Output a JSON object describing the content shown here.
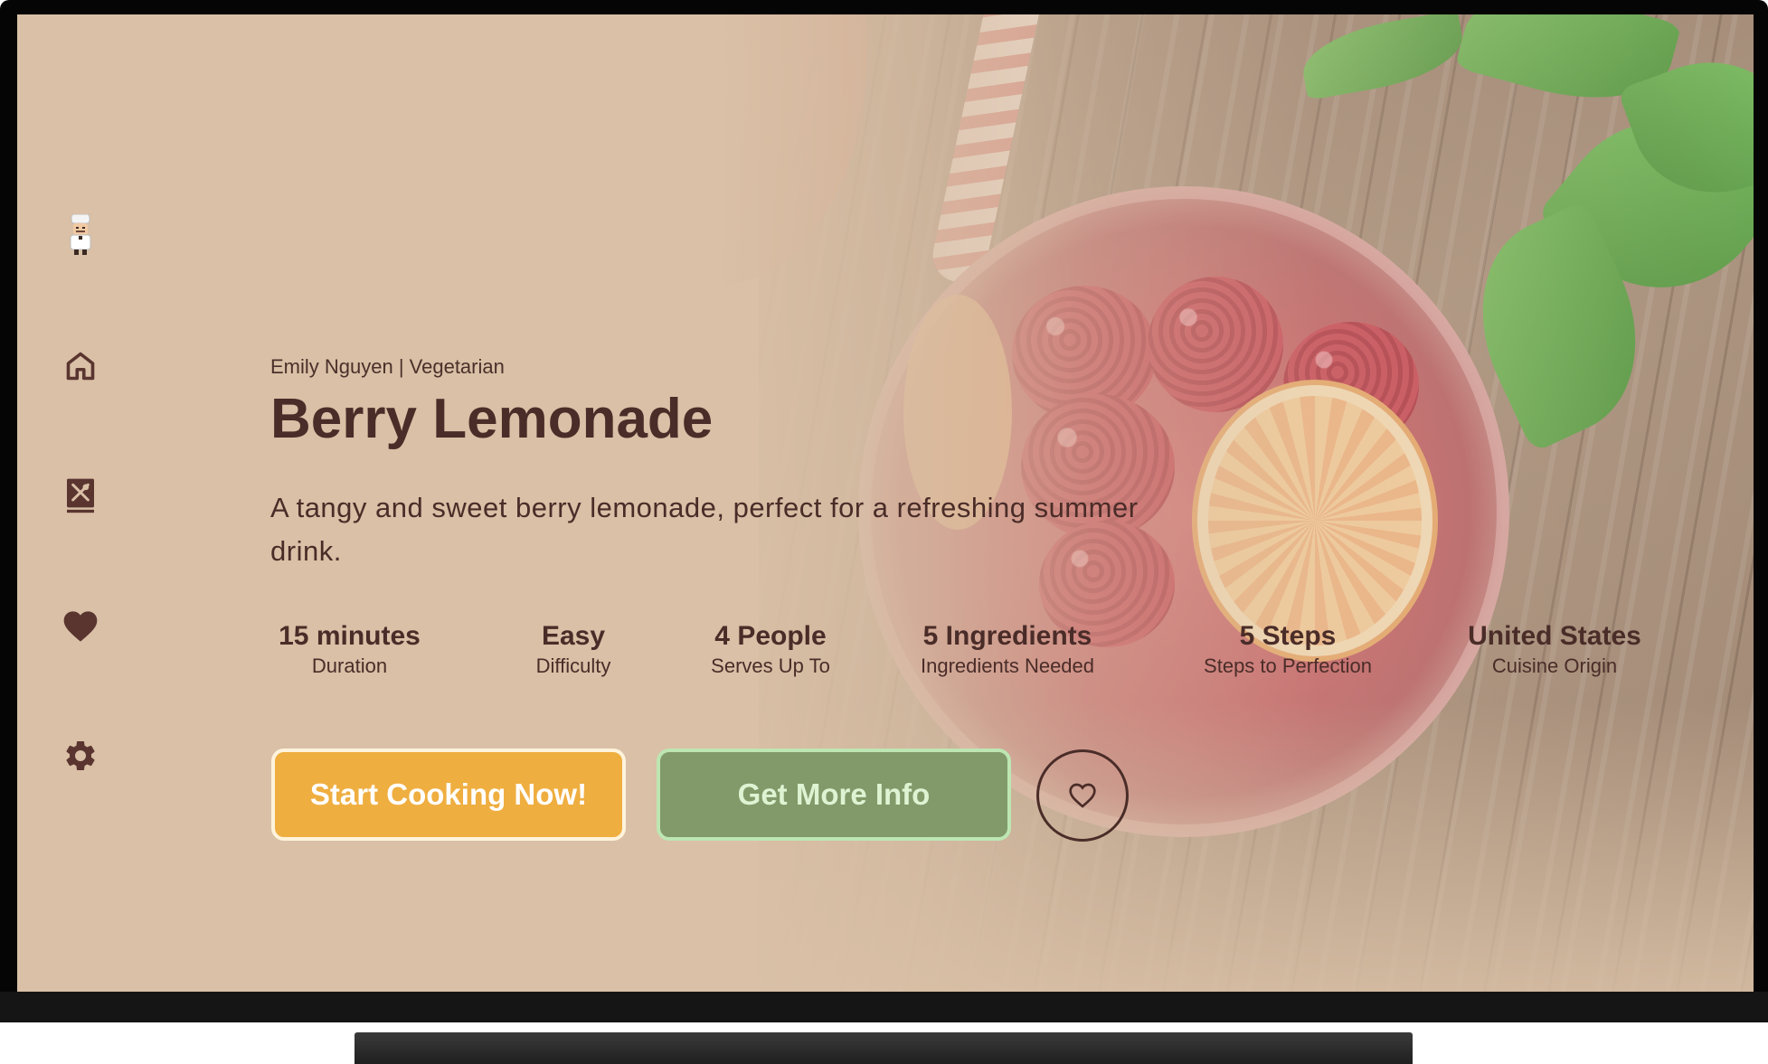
{
  "recipe": {
    "byline": "Emily Nguyen | Vegetarian",
    "title": "Berry Lemonade",
    "description": "A tangy and sweet berry lemonade, perfect for a refreshing summer drink."
  },
  "stats": [
    {
      "value": "15 minutes",
      "label": "Duration"
    },
    {
      "value": "Easy",
      "label": "Difficulty"
    },
    {
      "value": "4 People",
      "label": "Serves Up To"
    },
    {
      "value": "5 Ingredients",
      "label": "Ingredients Needed"
    },
    {
      "value": "5 Steps",
      "label": "Steps to Perfection"
    },
    {
      "value": "United States",
      "label": "Cuisine Origin"
    }
  ],
  "actions": {
    "start_label": "Start Cooking Now!",
    "info_label": "Get More Info",
    "favorite_icon": "heart-outline-icon"
  },
  "nav": {
    "items": [
      {
        "icon": "chef-avatar-icon"
      },
      {
        "icon": "home-icon"
      },
      {
        "icon": "recipe-book-icon"
      },
      {
        "icon": "heart-icon"
      },
      {
        "icon": "gear-icon"
      }
    ]
  },
  "colors": {
    "background": "#d9c0a6",
    "text": "#4a2c28",
    "start_button": "#efae40",
    "info_button": "#82996a",
    "info_button_border": "#bde6b2"
  }
}
